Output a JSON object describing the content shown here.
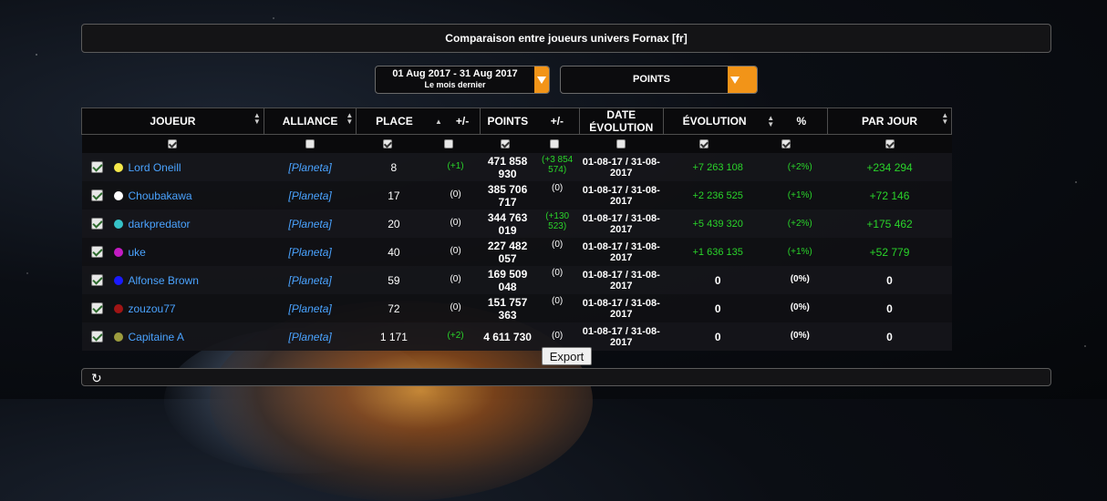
{
  "title": "Comparaison entre joueurs  univers Fornax  [fr]",
  "date_range": {
    "label": "01 Aug 2017 - 31 Aug 2017",
    "sublabel": "Le mois dernier"
  },
  "metric": {
    "selected": "POINTS"
  },
  "columns": {
    "joueur": "JOUEUR",
    "alliance": "ALLIANCE",
    "place": "PLACE",
    "place_delta": "+/-",
    "points": "POINTS",
    "points_delta": "+/-",
    "date_evolution": "DATE ÉVOLUTION",
    "evolution": "ÉVOLUTION",
    "percent": "%",
    "par_jour": "PAR JOUR"
  },
  "column_checks": [
    true,
    false,
    true,
    false,
    true,
    false,
    false,
    true,
    true,
    true
  ],
  "rows": [
    {
      "name": "Lord Oneill",
      "color": "#f5e84a",
      "alliance": "[Planeta]",
      "place": "8",
      "place_delta": "(+1)",
      "points": "471 858 930",
      "points_delta": "(+3 854 574)",
      "date": "01-08-17 / 31-08-2017",
      "evolution": "+7 263 108",
      "percent": "(+2%)",
      "par_jour": "+234 294"
    },
    {
      "name": "Choubakawa",
      "color": "#ffffff",
      "alliance": "[Planeta]",
      "place": "17",
      "place_delta": "(0)",
      "points": "385 706 717",
      "points_delta": "(0)",
      "date": "01-08-17 / 31-08-2017",
      "evolution": "+2 236 525",
      "percent": "(+1%)",
      "par_jour": "+72 146"
    },
    {
      "name": "darkpredator",
      "color": "#36c2c7",
      "alliance": "[Planeta]",
      "place": "20",
      "place_delta": "(0)",
      "points": "344 763 019",
      "points_delta": "(+130 523)",
      "date": "01-08-17 / 31-08-2017",
      "evolution": "+5 439 320",
      "percent": "(+2%)",
      "par_jour": "+175 462"
    },
    {
      "name": "uke",
      "color": "#c31bc3",
      "alliance": "[Planeta]",
      "place": "40",
      "place_delta": "(0)",
      "points": "227 482 057",
      "points_delta": "(0)",
      "date": "01-08-17 / 31-08-2017",
      "evolution": "+1 636 135",
      "percent": "(+1%)",
      "par_jour": "+52 779"
    },
    {
      "name": "Alfonse Brown",
      "color": "#1a1aff",
      "alliance": "[Planeta]",
      "place": "59",
      "place_delta": "(0)",
      "points": "169 509 048",
      "points_delta": "(0)",
      "date": "01-08-17 / 31-08-2017",
      "evolution": "0",
      "percent": "(0%)",
      "par_jour": "0"
    },
    {
      "name": "zouzou77",
      "color": "#a01515",
      "alliance": "[Planeta]",
      "place": "72",
      "place_delta": "(0)",
      "points": "151 757 363",
      "points_delta": "(0)",
      "date": "01-08-17 / 31-08-2017",
      "evolution": "0",
      "percent": "(0%)",
      "par_jour": "0"
    },
    {
      "name": "Capitaine A",
      "color": "#9c9c3e",
      "alliance": "[Planeta]",
      "place": "1 171",
      "place_delta": "(+2)",
      "points": "4 611 730",
      "points_delta": "(0)",
      "date": "01-08-17 / 31-08-2017",
      "evolution": "0",
      "percent": "(0%)",
      "par_jour": "0"
    }
  ],
  "export_label": "Export"
}
